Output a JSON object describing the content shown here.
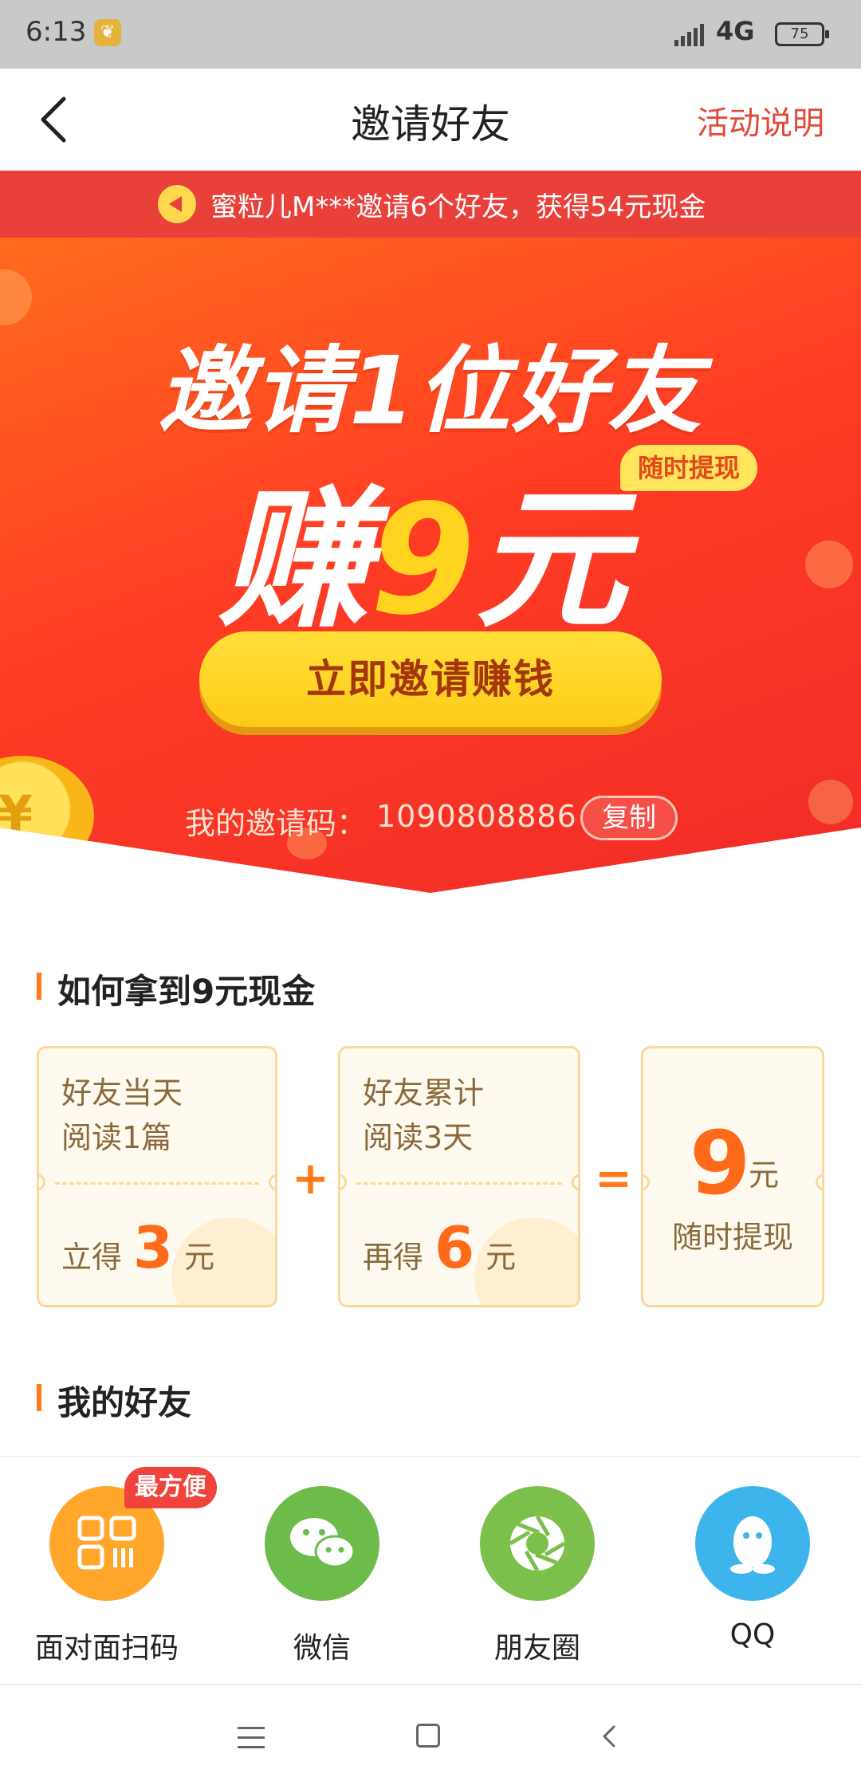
{
  "status_bar": {
    "time": "6:13",
    "network": "4G",
    "battery": "75"
  },
  "header": {
    "title": "邀请好友",
    "rules_link": "活动说明"
  },
  "ticker": {
    "text": "蜜粒儿M***邀请6个好友，获得54元现金"
  },
  "hero": {
    "title": "邀请1位好友",
    "earn_prefix": "赚",
    "earn_amount": "9",
    "earn_suffix": "元",
    "withdraw_tag": "随时提现",
    "invite_button": "立即邀请赚钱",
    "code_label": "我的邀请码：",
    "code_value": "1090808886",
    "copy_button": "复制"
  },
  "how_section": {
    "title": "如何拿到9元现金",
    "cards": [
      {
        "line1": "好友当天",
        "line2": "阅读1篇",
        "prefix": "立得",
        "amount": "3",
        "unit": "元"
      },
      {
        "line1": "好友累计",
        "line2": "阅读3天",
        "prefix": "再得",
        "amount": "6",
        "unit": "元"
      }
    ],
    "plus": "+",
    "equals": "=",
    "result": {
      "amount": "9",
      "unit": "元",
      "note": "随时提现"
    }
  },
  "friends_section": {
    "title": "我的好友"
  },
  "share": {
    "badge": "最方便",
    "items": [
      {
        "label": "面对面扫码",
        "icon": "qr-code-icon",
        "color": "#ffa62b"
      },
      {
        "label": "微信",
        "icon": "wechat-icon",
        "color": "#6dbb4b"
      },
      {
        "label": "朋友圈",
        "icon": "moments-icon",
        "color": "#7cc04b"
      },
      {
        "label": "QQ",
        "icon": "qq-icon",
        "color": "#3db5ec"
      }
    ]
  },
  "colors": {
    "accent": "#e24a3a",
    "ticker_bg": "#e9403a",
    "button_yellow": "#ffd31f",
    "orange": "#ff6a1a"
  }
}
